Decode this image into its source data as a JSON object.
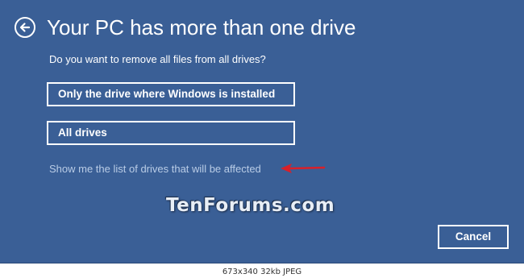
{
  "dialog": {
    "title": "Your PC has more than one drive",
    "question": "Do you want to remove all files from all drives?",
    "options": [
      {
        "label": "Only the drive where Windows is installed"
      },
      {
        "label": "All drives"
      }
    ],
    "link_text": "Show me the list of drives that will be affected",
    "cancel_label": "Cancel",
    "back_icon": "back-arrow-circle-icon",
    "annotation_icon": "red-arrow-icon"
  },
  "watermark": {
    "text": "TenForums.com"
  },
  "image_caption": {
    "text": "673x340  32kb  JPEG"
  },
  "colors": {
    "background": "#3a5f96",
    "text": "#ffffff",
    "link": "#b9cce6",
    "annotation_arrow": "#d8202a"
  }
}
